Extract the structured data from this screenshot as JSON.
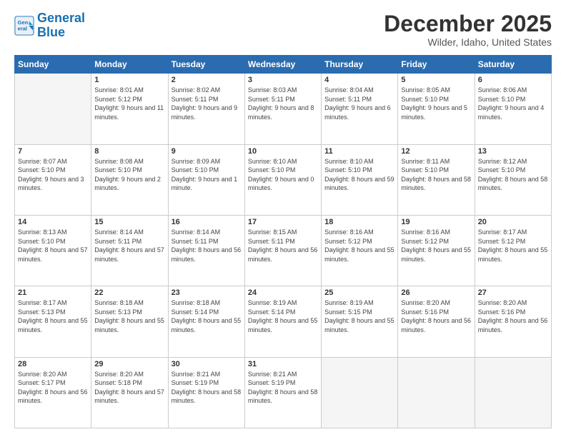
{
  "logo": {
    "line1": "General",
    "line2": "Blue"
  },
  "title": "December 2025",
  "location": "Wilder, Idaho, United States",
  "weekdays": [
    "Sunday",
    "Monday",
    "Tuesday",
    "Wednesday",
    "Thursday",
    "Friday",
    "Saturday"
  ],
  "days": [
    {
      "num": "",
      "sunrise": "",
      "sunset": "",
      "daylight": ""
    },
    {
      "num": "1",
      "sunrise": "8:01 AM",
      "sunset": "5:12 PM",
      "daylight": "9 hours and 11 minutes."
    },
    {
      "num": "2",
      "sunrise": "8:02 AM",
      "sunset": "5:11 PM",
      "daylight": "9 hours and 9 minutes."
    },
    {
      "num": "3",
      "sunrise": "8:03 AM",
      "sunset": "5:11 PM",
      "daylight": "9 hours and 8 minutes."
    },
    {
      "num": "4",
      "sunrise": "8:04 AM",
      "sunset": "5:11 PM",
      "daylight": "9 hours and 6 minutes."
    },
    {
      "num": "5",
      "sunrise": "8:05 AM",
      "sunset": "5:10 PM",
      "daylight": "9 hours and 5 minutes."
    },
    {
      "num": "6",
      "sunrise": "8:06 AM",
      "sunset": "5:10 PM",
      "daylight": "9 hours and 4 minutes."
    },
    {
      "num": "7",
      "sunrise": "8:07 AM",
      "sunset": "5:10 PM",
      "daylight": "9 hours and 3 minutes."
    },
    {
      "num": "8",
      "sunrise": "8:08 AM",
      "sunset": "5:10 PM",
      "daylight": "9 hours and 2 minutes."
    },
    {
      "num": "9",
      "sunrise": "8:09 AM",
      "sunset": "5:10 PM",
      "daylight": "9 hours and 1 minute."
    },
    {
      "num": "10",
      "sunrise": "8:10 AM",
      "sunset": "5:10 PM",
      "daylight": "9 hours and 0 minutes."
    },
    {
      "num": "11",
      "sunrise": "8:10 AM",
      "sunset": "5:10 PM",
      "daylight": "8 hours and 59 minutes."
    },
    {
      "num": "12",
      "sunrise": "8:11 AM",
      "sunset": "5:10 PM",
      "daylight": "8 hours and 58 minutes."
    },
    {
      "num": "13",
      "sunrise": "8:12 AM",
      "sunset": "5:10 PM",
      "daylight": "8 hours and 58 minutes."
    },
    {
      "num": "14",
      "sunrise": "8:13 AM",
      "sunset": "5:10 PM",
      "daylight": "8 hours and 57 minutes."
    },
    {
      "num": "15",
      "sunrise": "8:14 AM",
      "sunset": "5:11 PM",
      "daylight": "8 hours and 57 minutes."
    },
    {
      "num": "16",
      "sunrise": "8:14 AM",
      "sunset": "5:11 PM",
      "daylight": "8 hours and 56 minutes."
    },
    {
      "num": "17",
      "sunrise": "8:15 AM",
      "sunset": "5:11 PM",
      "daylight": "8 hours and 56 minutes."
    },
    {
      "num": "18",
      "sunrise": "8:16 AM",
      "sunset": "5:12 PM",
      "daylight": "8 hours and 55 minutes."
    },
    {
      "num": "19",
      "sunrise": "8:16 AM",
      "sunset": "5:12 PM",
      "daylight": "8 hours and 55 minutes."
    },
    {
      "num": "20",
      "sunrise": "8:17 AM",
      "sunset": "5:12 PM",
      "daylight": "8 hours and 55 minutes."
    },
    {
      "num": "21",
      "sunrise": "8:17 AM",
      "sunset": "5:13 PM",
      "daylight": "8 hours and 55 minutes."
    },
    {
      "num": "22",
      "sunrise": "8:18 AM",
      "sunset": "5:13 PM",
      "daylight": "8 hours and 55 minutes."
    },
    {
      "num": "23",
      "sunrise": "8:18 AM",
      "sunset": "5:14 PM",
      "daylight": "8 hours and 55 minutes."
    },
    {
      "num": "24",
      "sunrise": "8:19 AM",
      "sunset": "5:14 PM",
      "daylight": "8 hours and 55 minutes."
    },
    {
      "num": "25",
      "sunrise": "8:19 AM",
      "sunset": "5:15 PM",
      "daylight": "8 hours and 55 minutes."
    },
    {
      "num": "26",
      "sunrise": "8:20 AM",
      "sunset": "5:16 PM",
      "daylight": "8 hours and 56 minutes."
    },
    {
      "num": "27",
      "sunrise": "8:20 AM",
      "sunset": "5:16 PM",
      "daylight": "8 hours and 56 minutes."
    },
    {
      "num": "28",
      "sunrise": "8:20 AM",
      "sunset": "5:17 PM",
      "daylight": "8 hours and 56 minutes."
    },
    {
      "num": "29",
      "sunrise": "8:20 AM",
      "sunset": "5:18 PM",
      "daylight": "8 hours and 57 minutes."
    },
    {
      "num": "30",
      "sunrise": "8:21 AM",
      "sunset": "5:19 PM",
      "daylight": "8 hours and 58 minutes."
    },
    {
      "num": "31",
      "sunrise": "8:21 AM",
      "sunset": "5:19 PM",
      "daylight": "8 hours and 58 minutes."
    }
  ]
}
